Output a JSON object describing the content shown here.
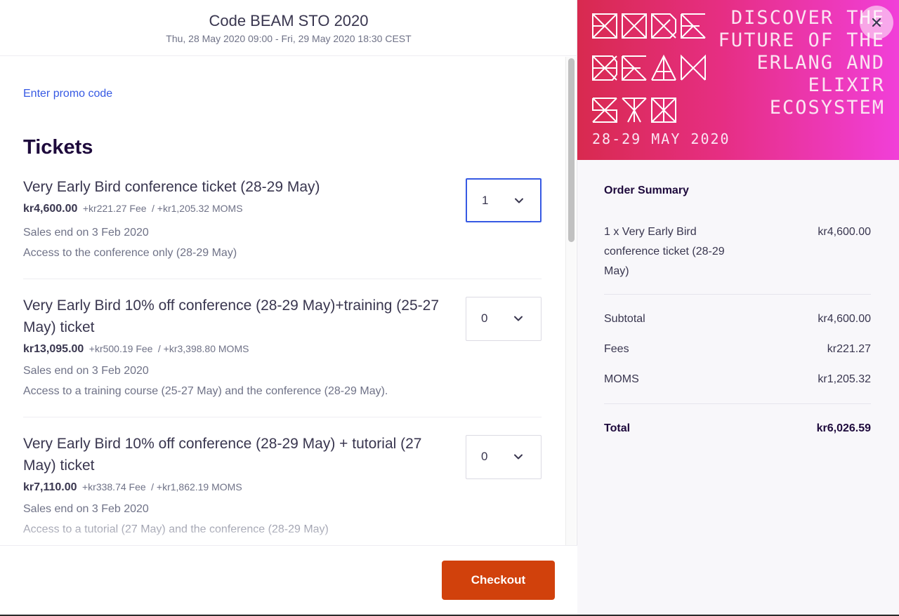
{
  "event": {
    "title": "Code BEAM STO 2020",
    "date_range": "Thu, 28 May 2020 09:00 - Fri, 29 May 2020 18:30 CEST"
  },
  "promo": {
    "label": "Enter promo code"
  },
  "tickets_heading": "Tickets",
  "tickets": [
    {
      "name": "Very Early Bird conference ticket (28-29 May)",
      "price": "kr4,600.00",
      "fee": "+kr221.27 Fee",
      "moms": "/ +kr1,205.32 MOMS",
      "sales_end": "Sales end on 3 Feb 2020",
      "description": "Access to the conference only (28-29 May)",
      "quantity": "1"
    },
    {
      "name": "Very Early Bird 10% off conference (28-29 May)+training (25-27 May) ticket",
      "price": "kr13,095.00",
      "fee": "+kr500.19 Fee",
      "moms": "/ +kr3,398.80 MOMS",
      "sales_end": "Sales end on 3 Feb 2020",
      "description": "Access to a  training course (25-27 May) and the conference (28-29 May).",
      "quantity": "0"
    },
    {
      "name": "Very Early Bird 10% off conference (28-29 May) + tutorial (27 May) ticket",
      "price": "kr7,110.00",
      "fee": "+kr338.74 Fee",
      "moms": "/ +kr1,862.19 MOMS",
      "sales_end": "Sales end on 3 Feb 2020",
      "description": "Access to  a tutorial (27 May) and the conference (28-29 May)",
      "quantity": "0"
    }
  ],
  "checkout": {
    "label": "Checkout",
    "color": "#d1410c"
  },
  "banner": {
    "logo_lines": [
      "CODE",
      "BEAM",
      "STO"
    ],
    "tagline": [
      "DISCOVER THE",
      "FUTURE OF THE",
      "ERLANG AND",
      "ELIXIR",
      "ECOSYSTEM"
    ],
    "date": "28-29 MAY 2020"
  },
  "close_icon": "close-icon",
  "summary": {
    "title": "Order Summary",
    "item_name": "1 x Very Early Bird conference ticket (28-29 May)",
    "item_amount": "kr4,600.00",
    "subtotal_label": "Subtotal",
    "subtotal": "kr4,600.00",
    "fees_label": "Fees",
    "fees": "kr221.27",
    "moms_label": "MOMS",
    "moms": "kr1,205.32",
    "total_label": "Total",
    "total": "kr6,026.59"
  }
}
